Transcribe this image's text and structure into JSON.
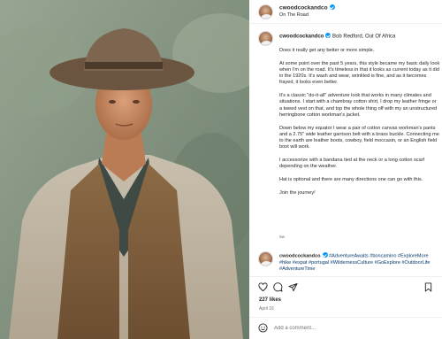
{
  "post": {
    "username": "cwoodcockandco",
    "location": "On The Road",
    "photo_subject": "Bob Redford, Out Of Africa",
    "caption": [
      "Does it really get any better or more simple.",
      "At some point over the past 5 years, this style became my basic daily look when I'm on the road. It's timeless in that it looks as current today as it did in the 1920s. It's wash and wear, wrinkled is fine, and as it becomes frayed, it looks even better.",
      "It's a classic \"do-it-all\" adventure look that works in many climates and situations. I start with a chambray cotton shirt, I drop my leather fringe or a tweed vest on that, and top the whole thing off with my an unstructured herringbone cotton workman's jacket.",
      "Down below my equator I wear a pair of cotton canvas workman's pants and a 2.75\" wide leather garrison belt with a brass buckle. Connecting me to the earth are leather boots, cowboy, field moccasin, or an English field boot will work.",
      "I accessorize with a bandana tied at the neck or a long cotton scarf depending on the weather.",
      "Hat is optional and there are many directions one can go with this.",
      "Join the journey!"
    ],
    "caption_time": "9w",
    "comment": {
      "username": "cwoodcockandco",
      "tags": "#AdventureAwaits #boncamino #ExploreMore #hike #expat #portugal #WildernessCulture #GoExplore #OutdoorLife #AdventureTime"
    },
    "likes": "227 likes",
    "date": "April 16",
    "add_comment_placeholder": "Add a comment..."
  },
  "icons": {
    "like": "heart-icon",
    "comment": "comment-bubble-icon",
    "share": "paper-plane-icon",
    "save": "bookmark-icon",
    "emoji": "smiley-icon",
    "verified": "verified-badge-icon"
  },
  "colors": {
    "verified": "#0095f6",
    "hashtag": "#00376b",
    "muted": "#737373"
  }
}
